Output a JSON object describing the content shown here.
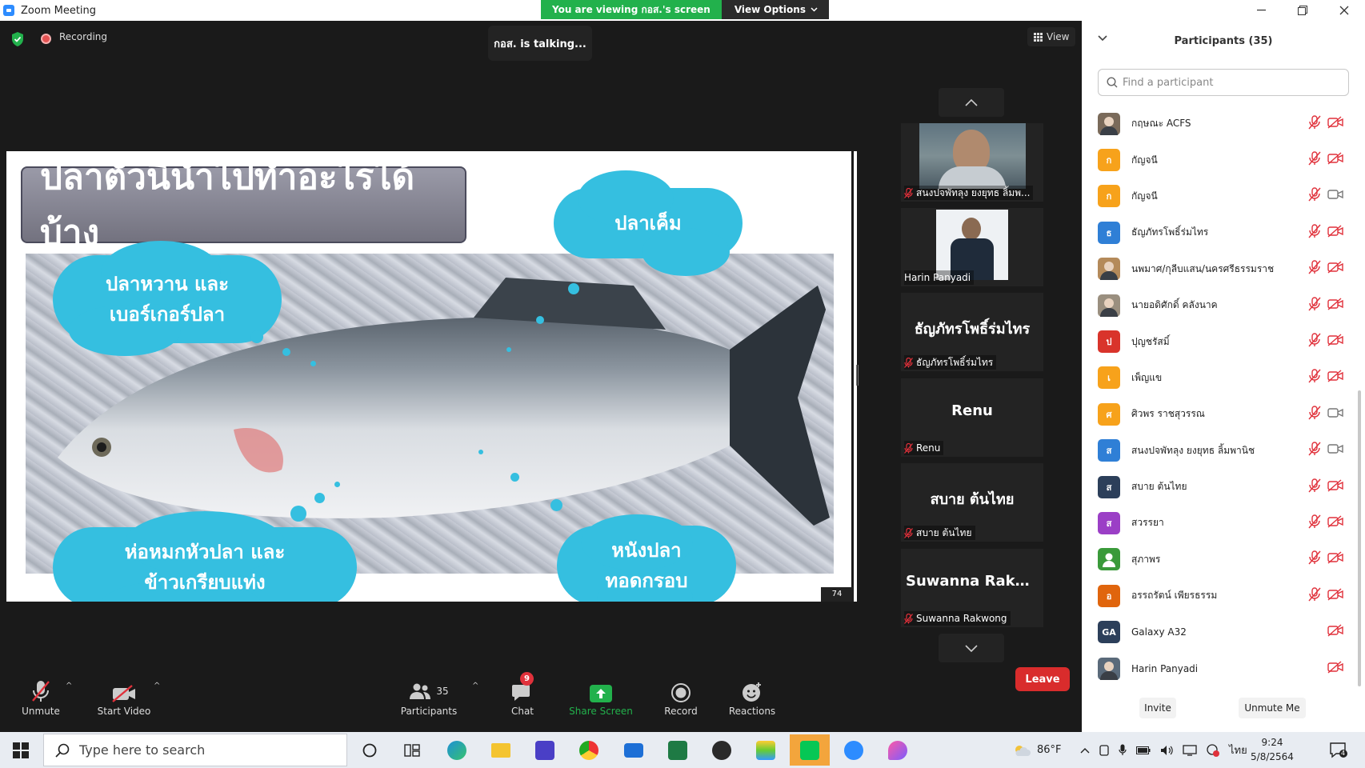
{
  "window": {
    "title": "Zoom Meeting"
  },
  "share_banner": {
    "viewing": "You are viewing กอส.'s screen",
    "view_options": "View Options"
  },
  "meeting": {
    "recording_label": "Recording",
    "talking": "กอส. is talking...",
    "view_label": "View"
  },
  "slide": {
    "title": "ปลาตัวนี้นำไปทำอะไรได้บ้าง",
    "cloud_top": "ปลาเค็ม",
    "cloud_tl_1": "ปลาหวาน และ",
    "cloud_tl_2": "เบอร์เกอร์ปลา",
    "cloud_bl_1": "ห่อหมกหัวปลา และ",
    "cloud_bl_2": "ข้าวเกรียบแท่ง",
    "cloud_br_1": "หนังปลา",
    "cloud_br_2": "ทอดกรอบ",
    "page_indicator": "74"
  },
  "tiles": [
    {
      "label": "สนงปจพัทลุง ยงยุทธ ลิ้มพ...",
      "big_name": "",
      "kind": "video",
      "muted": true
    },
    {
      "label": "Harin Panyadi",
      "big_name": "",
      "kind": "video-portrait",
      "muted": false
    },
    {
      "label": "ธัญภัทรโพธิ์ร่มไทร",
      "big_name": "ธัญภัทรโพธิ์ร่มไทร",
      "kind": "name",
      "muted": true
    },
    {
      "label": "Renu",
      "big_name": "Renu",
      "kind": "name",
      "muted": true
    },
    {
      "label": "สบาย ต้นไทย",
      "big_name": "สบาย ต้นไทย",
      "kind": "name",
      "muted": true
    },
    {
      "label": "Suwanna Rakwong",
      "big_name": "Suwanna Rakw...",
      "kind": "name",
      "muted": true
    }
  ],
  "toolbar": {
    "unmute": "Unmute",
    "start_video": "Start Video",
    "participants": "Participants",
    "participants_count": "35",
    "chat": "Chat",
    "chat_badge": "9",
    "share_screen": "Share Screen",
    "record": "Record",
    "reactions": "Reactions",
    "leave": "Leave"
  },
  "panel": {
    "title": "Participants (35)",
    "search_placeholder": "Find a participant",
    "invite": "Invite",
    "unmute_me": "Unmute Me",
    "participants": [
      {
        "name": "กฤษณะ ACFS",
        "avatar_type": "photo",
        "initial": "",
        "color": "#7a6a5a",
        "mic_muted": true,
        "cam_off": true
      },
      {
        "name": "กัญจนี",
        "avatar_type": "letter",
        "initial": "ก",
        "color": "#f7a21b",
        "mic_muted": true,
        "cam_off": true
      },
      {
        "name": "กัญจนี",
        "avatar_type": "letter",
        "initial": "ก",
        "color": "#f7a21b",
        "mic_muted": true,
        "cam_off": false
      },
      {
        "name": "ธัญภัทรโพธิ์ร่มไทร",
        "avatar_type": "letter",
        "initial": "ธ",
        "color": "#2f7fd6",
        "mic_muted": true,
        "cam_off": true
      },
      {
        "name": "นพมาศ/กุลีบแสน/นครศรีธรรมราช",
        "avatar_type": "photo",
        "initial": "",
        "color": "#b48a5a",
        "mic_muted": true,
        "cam_off": true
      },
      {
        "name": "นายอดิศักดิ์ คลังนาค",
        "avatar_type": "photo",
        "initial": "",
        "color": "#9a8f7f",
        "mic_muted": true,
        "cam_off": true
      },
      {
        "name": "ปุญชรัสมิ์",
        "avatar_type": "letter",
        "initial": "ป",
        "color": "#d9342b",
        "mic_muted": true,
        "cam_off": true
      },
      {
        "name": "เพ็ญแข",
        "avatar_type": "letter",
        "initial": "เ",
        "color": "#f7a21b",
        "mic_muted": true,
        "cam_off": true
      },
      {
        "name": "ศิวพร ราชสุวรรณ",
        "avatar_type": "letter",
        "initial": "ศ",
        "color": "#f7a21b",
        "mic_muted": true,
        "cam_off": false
      },
      {
        "name": "สนงปจพัทลุง ยงยุทธ ลิ้มพานิช",
        "avatar_type": "letter",
        "initial": "ส",
        "color": "#2f7fd6",
        "mic_muted": true,
        "cam_off": false
      },
      {
        "name": "สบาย ต้นไทย",
        "avatar_type": "letter",
        "initial": "ส",
        "color": "#2c3f5a",
        "mic_muted": true,
        "cam_off": true
      },
      {
        "name": "สวรรยา",
        "avatar_type": "letter",
        "initial": "ส",
        "color": "#9b3fc6",
        "mic_muted": true,
        "cam_off": true
      },
      {
        "name": "สุภาพร",
        "avatar_type": "person",
        "initial": "",
        "color": "#3a9a3a",
        "mic_muted": true,
        "cam_off": true
      },
      {
        "name": "อรรถรัตน์ เพียรธรรม",
        "avatar_type": "letter",
        "initial": "อ",
        "color": "#e0650d",
        "mic_muted": true,
        "cam_off": true
      },
      {
        "name": "Galaxy A32",
        "avatar_type": "letter",
        "initial": "GA",
        "color": "#2c3f5a",
        "mic_muted": false,
        "cam_off": true
      },
      {
        "name": "Harin Panyadi",
        "avatar_type": "photo",
        "initial": "",
        "color": "#5a6a7a",
        "mic_muted": false,
        "cam_off": true
      }
    ]
  },
  "taskbar": {
    "search_placeholder": "Type here to search",
    "weather": "86°F",
    "language": "ไทย",
    "time": "9:24",
    "date": "5/8/2564",
    "notification_count": "4"
  },
  "colors": {
    "accent_green": "#22b14c",
    "leave_red": "#d92c2c",
    "cloud_blue": "#35bfe0",
    "muted_red": "#e0313b"
  }
}
